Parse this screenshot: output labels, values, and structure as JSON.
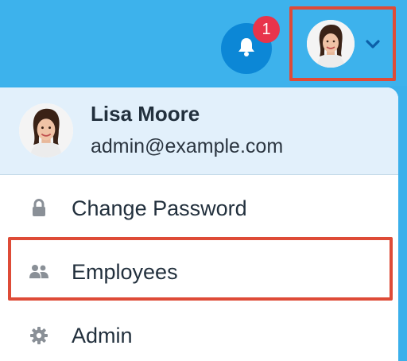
{
  "notifications": {
    "count": "1",
    "icon": "bell-icon"
  },
  "user_menu": {
    "chevron_icon": "chevron-down-icon",
    "avatar_icon": "avatar"
  },
  "profile": {
    "name": "Lisa Moore",
    "email": "admin@example.com"
  },
  "menu": {
    "items": [
      {
        "label": "Change Password",
        "icon": "lock-icon"
      },
      {
        "label": "Employees",
        "icon": "users-icon"
      },
      {
        "label": "Admin",
        "icon": "gear-icon"
      }
    ]
  },
  "colors": {
    "topbar": "#3db2ec",
    "bell_button": "#0c87d6",
    "badge": "#e8344b",
    "highlight_border": "#de4b37",
    "profile_bg": "#e2f0fb"
  }
}
